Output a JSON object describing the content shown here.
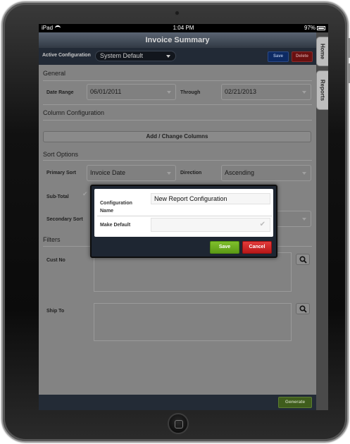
{
  "status_bar": {
    "carrier": "iPad",
    "time": "1:04 PM",
    "battery": "97%"
  },
  "side_tabs": [
    "Home",
    "Reports"
  ],
  "title": "Invoice Summary",
  "toolbar": {
    "active_config_label": "Active Configuration",
    "active_config_value": "System Default",
    "save_label": "Save",
    "delete_label": "Delete"
  },
  "general": {
    "heading": "General",
    "date_range_label": "Date Range",
    "date_range_value": "06/01/2011",
    "through_label": "Through",
    "through_value": "02/21/2013"
  },
  "column_config": {
    "heading": "Column Configuration",
    "button_label": "Add / Change Columns"
  },
  "sort_options": {
    "heading": "Sort Options",
    "primary_sort_label": "Primary Sort",
    "primary_sort_value": "Invoice Date",
    "direction_label": "Direction",
    "direction_value": "Ascending",
    "subtotal_label": "Sub-Total",
    "secondary_sort_label": "Secondary Sort"
  },
  "filters": {
    "heading": "Filters",
    "cust_no_label": "Cust No",
    "ship_to_label": "Ship To"
  },
  "bottom_bar": {
    "generate_label": "Generate"
  },
  "modal": {
    "config_name_label": "Configuration Name",
    "config_name_value": "New Report Configuration",
    "make_default_label": "Make Default",
    "save_label": "Save",
    "cancel_label": "Cancel"
  }
}
